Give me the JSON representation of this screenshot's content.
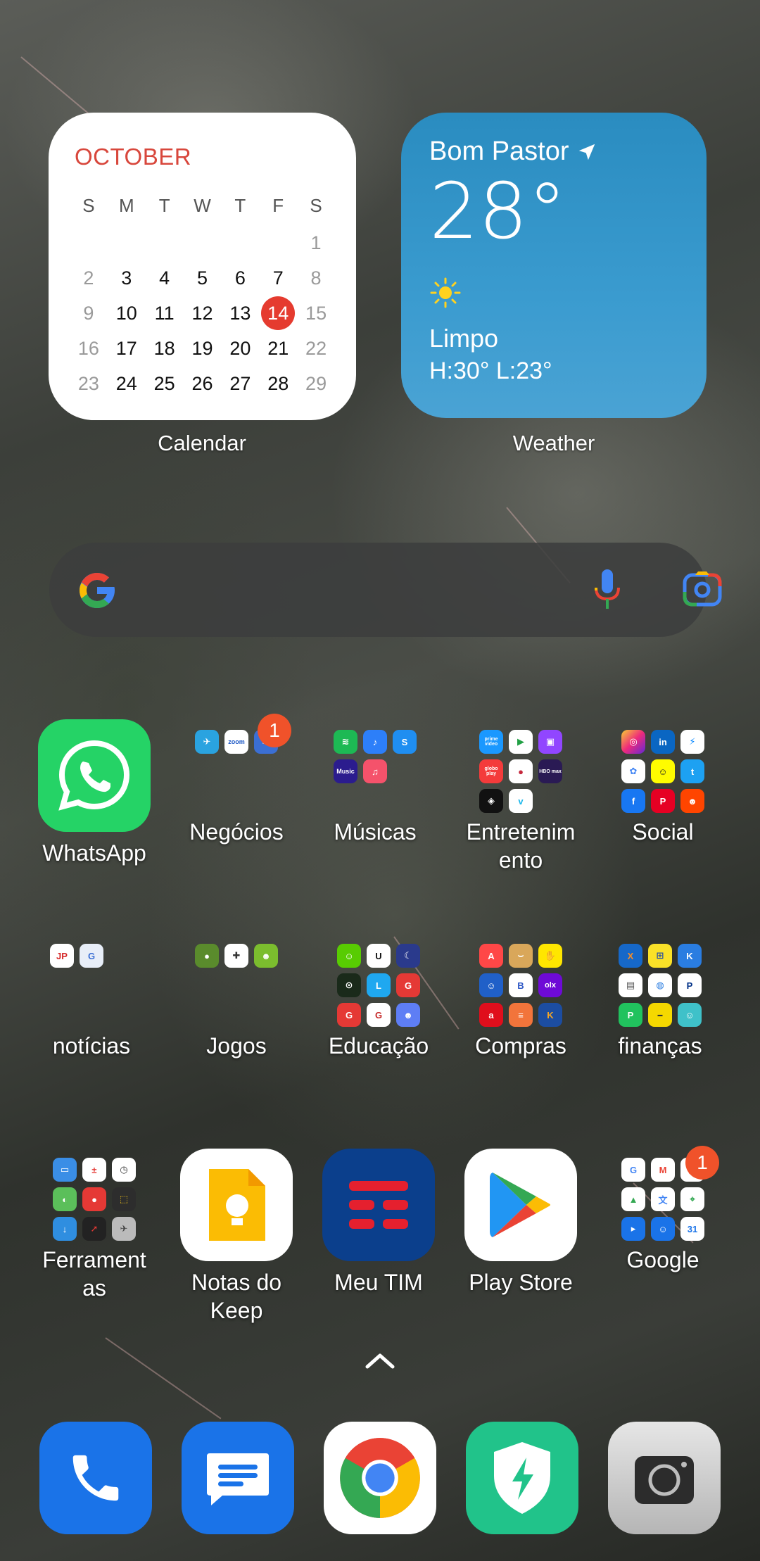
{
  "calendar": {
    "month": "OCTOBER",
    "weekdays": [
      "S",
      "M",
      "T",
      "W",
      "T",
      "F",
      "S"
    ],
    "days": [
      [
        "",
        "",
        "",
        "",
        "",
        "",
        "1"
      ],
      [
        "2",
        "3",
        "4",
        "5",
        "6",
        "7",
        "8"
      ],
      [
        "9",
        "10",
        "11",
        "12",
        "13",
        "14",
        "15"
      ],
      [
        "16",
        "17",
        "18",
        "19",
        "20",
        "21",
        "22"
      ],
      [
        "23",
        "24",
        "25",
        "26",
        "27",
        "28",
        "29"
      ]
    ],
    "today": "14",
    "label": "Calendar"
  },
  "weather": {
    "location": "Bom Pastor",
    "temperature": "28°",
    "condition": "Limpo",
    "high_low": "H:30°  L:23°",
    "label": "Weather",
    "condition_icon": "sun-icon"
  },
  "search": {
    "google_icon": "google-g-icon",
    "mic_icon": "mic-icon",
    "lens_icon": "google-lens-icon"
  },
  "apps": {
    "row1": [
      {
        "label": "WhatsApp",
        "icon": "whatsapp-icon"
      },
      {
        "label": "Negócios",
        "badge": "1",
        "icon": "folder-icon"
      },
      {
        "label": "Músicas",
        "icon": "folder-icon"
      },
      {
        "label": "Entretenim\nento",
        "icon": "folder-icon"
      },
      {
        "label": "Social",
        "icon": "folder-icon"
      }
    ],
    "row2": [
      {
        "label": "notícias",
        "icon": "folder-icon"
      },
      {
        "label": "Jogos",
        "icon": "folder-icon"
      },
      {
        "label": "Educação",
        "icon": "folder-icon"
      },
      {
        "label": "Compras",
        "icon": "folder-icon"
      },
      {
        "label": "finanças",
        "icon": "folder-icon"
      }
    ],
    "row3": [
      {
        "label": "Ferrament\nas",
        "icon": "folder-icon"
      },
      {
        "label": "Notas do\nKeep",
        "icon": "keep-icon"
      },
      {
        "label": "Meu TIM",
        "icon": "tim-icon"
      },
      {
        "label": "Play Store",
        "icon": "play-store-icon"
      },
      {
        "label": "Google",
        "badge": "1",
        "icon": "folder-icon"
      }
    ]
  },
  "folder_contents": {
    "musicas": [
      "Music"
    ],
    "entretenimento": [
      "prime video",
      "globo play",
      "HBO max"
    ],
    "compras": [
      "olx"
    ]
  },
  "dock": [
    {
      "name": "phone",
      "icon": "phone-icon"
    },
    {
      "name": "messages",
      "icon": "messages-icon"
    },
    {
      "name": "chrome",
      "icon": "chrome-icon"
    },
    {
      "name": "security",
      "icon": "shield-bolt-icon"
    },
    {
      "name": "camera",
      "icon": "camera-icon"
    }
  ],
  "colors": {
    "calendar_accent": "#d8473c",
    "today": "#e53b2f",
    "weather_bg": "#3a9bcf",
    "badge": "#f0522a",
    "whatsapp": "#25d366",
    "tim": "#0b3f8c"
  }
}
